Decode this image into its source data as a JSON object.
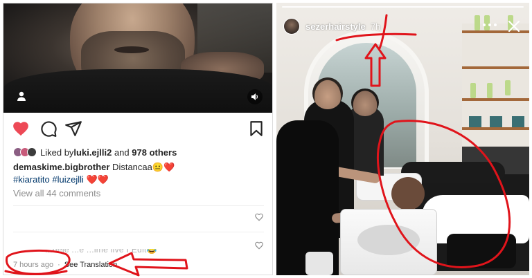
{
  "post": {
    "liked_by_prefix": "Liked by ",
    "liked_by_user": "luki.ejlli2",
    "liked_by_joiner": " and ",
    "liked_by_count": "978 others",
    "caption_user": "demaskime.bigbrother",
    "caption_text": " Distancaa😐❤️",
    "tags": "#kiaratito #luizejlli ❤️❤️",
    "view_all_comments": "View all 44 comments",
    "cut_comment": "...deje ...e ...ime live I Edit😂",
    "time": "7 hours ago",
    "separator": "·",
    "translation_link": "See Translation",
    "icons": {
      "like": "heart-filled-icon",
      "comment": "comment-bubble-icon",
      "share": "paper-plane-icon",
      "save": "bookmark-icon",
      "video_user": "user-icon",
      "sound": "speaker-icon",
      "comment_like": "small-heart-icon"
    },
    "like_color": "#ed4956"
  },
  "story": {
    "username": "sezerhairstyle",
    "time": "7h",
    "icons": {
      "more": "more-dots-icon",
      "close": "close-icon"
    }
  },
  "annotation_color": "#e0141b"
}
